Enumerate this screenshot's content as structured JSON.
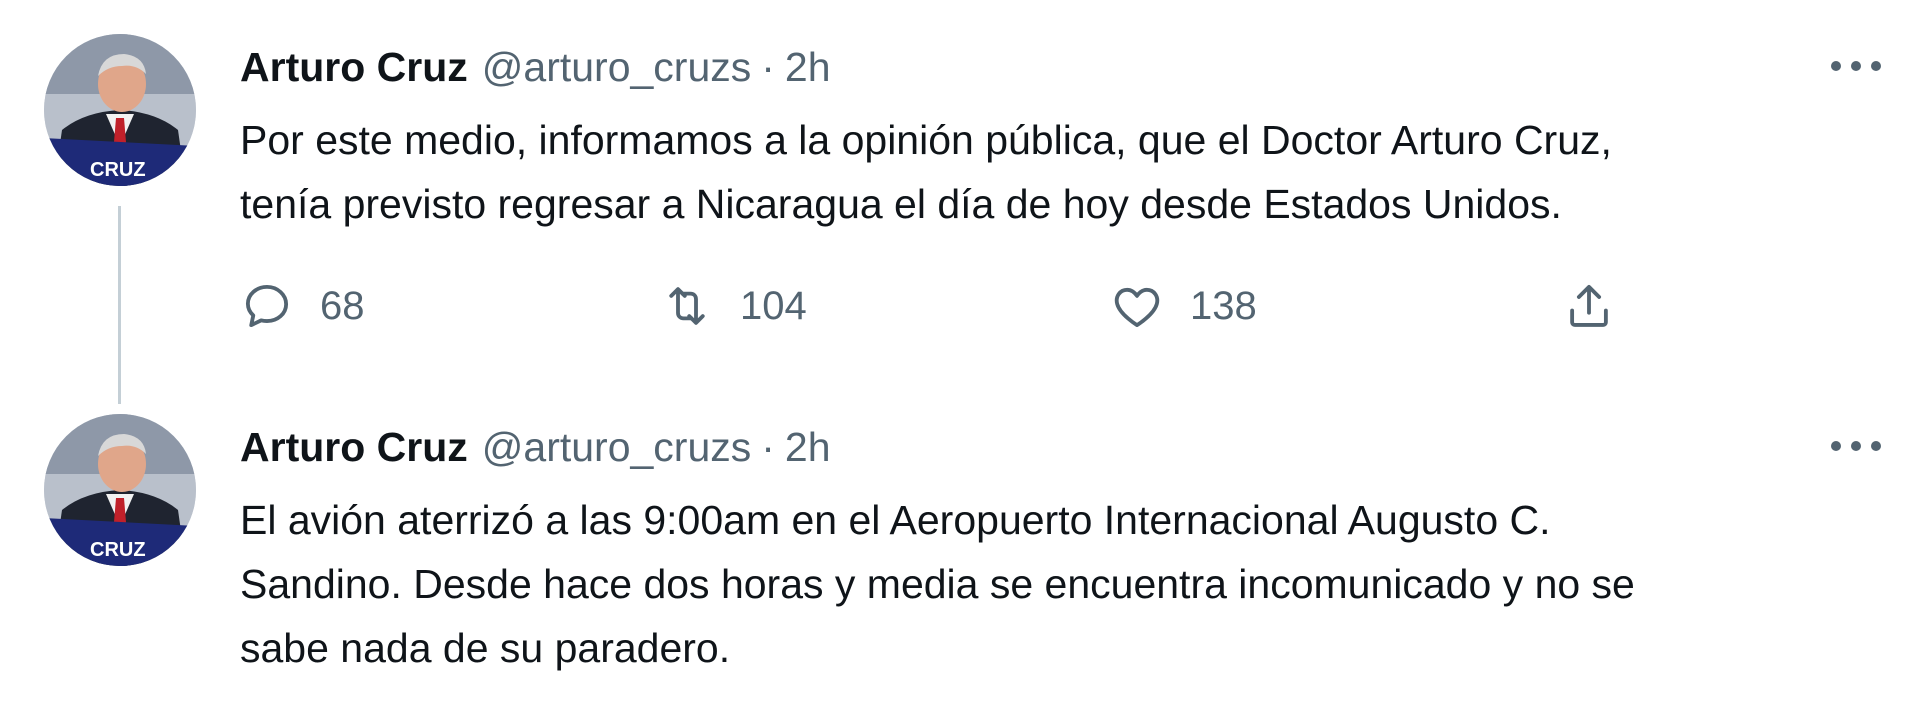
{
  "tweets": [
    {
      "name": "Arturo Cruz",
      "handle": "@arturo_cruzs",
      "separator": "·",
      "time": "2h",
      "text_lines": [
        "Por este medio, informamos a la opinión pública, que el Doctor Arturo Cruz,",
        "tenía previsto regresar a Nicaragua el día de hoy desde Estados Unidos."
      ],
      "actions": {
        "replies": "68",
        "retweets": "104",
        "likes": "138"
      }
    },
    {
      "name": "Arturo Cruz",
      "handle": "@arturo_cruzs",
      "separator": "·",
      "time": "2h",
      "text_lines": [
        "El avión aterrizó a las 9:00am en el Aeropuerto Internacional Augusto C.",
        "Sandino. Desde hace dos horas y media se encuentra incomunicado y no se",
        "sabe nada de su paradero."
      ]
    }
  ],
  "avatar_badge_text": "CRUZ",
  "icons": {
    "more": "more-horizontal-icon",
    "reply": "reply-bubble-icon",
    "retweet": "retweet-arrows-icon",
    "like": "heart-icon",
    "share": "share-upload-icon"
  },
  "colors": {
    "text_primary": "#0f1419",
    "text_secondary": "#536471",
    "thread_line": "#c4cfd6",
    "avatar_badge": "#1e2a78"
  }
}
